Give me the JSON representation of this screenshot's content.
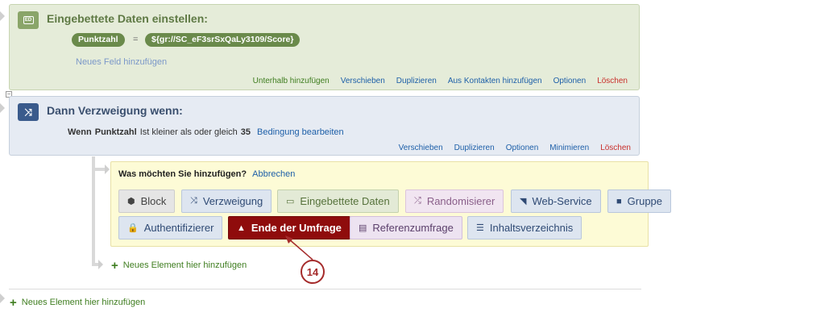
{
  "embedded_data": {
    "badge": "ED",
    "title": "Eingebettete Daten einstellen:",
    "field_name": "Punktzahl",
    "equals": "=",
    "field_value": "${gr://SC_eF3srSxQaLy3109/Score}",
    "add_field": "Neues Feld hinzufügen",
    "actions": {
      "add_below": "Unterhalb hinzufügen",
      "move": "Verschieben",
      "duplicate": "Duplizieren",
      "from_contacts": "Aus Kontakten hinzufügen",
      "options": "Optionen",
      "delete": "Löschen"
    }
  },
  "branch": {
    "title": "Dann Verzweigung wenn:",
    "condition": {
      "if_word": "Wenn",
      "field": "Punktzahl",
      "operator": "Ist kleiner als oder gleich",
      "value": "35",
      "edit": "Bedingung bearbeiten"
    },
    "actions": {
      "move": "Verschieben",
      "duplicate": "Duplizieren",
      "options": "Optionen",
      "minimize": "Minimieren",
      "delete": "Löschen"
    }
  },
  "add_panel": {
    "question": "Was möchten Sie hinzufügen?",
    "cancel": "Abbrechen",
    "buttons": {
      "block": "Block",
      "branch": "Verzweigung",
      "embedded": "Eingebettete Daten",
      "randomizer": "Randomisierer",
      "webservice": "Web-Service",
      "group": "Gruppe",
      "authenticator": "Authentifizierer",
      "end_survey": "Ende der Umfrage",
      "reference_survey": "Referenzumfrage",
      "toc": "Inhaltsverzeichnis"
    }
  },
  "add_element_inner": "Neues Element hier hinzufügen",
  "add_element_outer": "Neues Element hier hinzufügen",
  "callout_number": "14",
  "colors": {
    "end_survey_bg": "#8f0c0c",
    "accent_green": "#3e7d1f",
    "link_blue": "#1d5fa8",
    "delete_red": "#c9302c",
    "callout": "#a52b2b"
  }
}
